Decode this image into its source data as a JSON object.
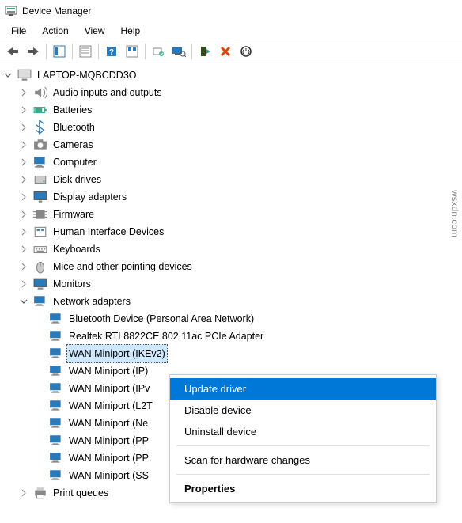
{
  "window": {
    "title": "Device Manager"
  },
  "menubar": [
    "File",
    "Action",
    "View",
    "Help"
  ],
  "root": {
    "name": "LAPTOP-MQBCDD3O"
  },
  "categories": [
    {
      "label": "Audio inputs and outputs",
      "icon": "speaker",
      "expanded": false
    },
    {
      "label": "Batteries",
      "icon": "battery",
      "expanded": false
    },
    {
      "label": "Bluetooth",
      "icon": "bluetooth",
      "expanded": false
    },
    {
      "label": "Cameras",
      "icon": "camera",
      "expanded": false
    },
    {
      "label": "Computer",
      "icon": "computer",
      "expanded": false
    },
    {
      "label": "Disk drives",
      "icon": "disk",
      "expanded": false
    },
    {
      "label": "Display adapters",
      "icon": "display",
      "expanded": false
    },
    {
      "label": "Firmware",
      "icon": "firmware",
      "expanded": false
    },
    {
      "label": "Human Interface Devices",
      "icon": "hid",
      "expanded": false
    },
    {
      "label": "Keyboards",
      "icon": "keyboard",
      "expanded": false
    },
    {
      "label": "Mice and other pointing devices",
      "icon": "mouse",
      "expanded": false
    },
    {
      "label": "Monitors",
      "icon": "monitor",
      "expanded": false
    },
    {
      "label": "Network adapters",
      "icon": "network",
      "expanded": true
    },
    {
      "label": "Print queues",
      "icon": "printer",
      "expanded": false
    }
  ],
  "network_children": [
    {
      "label": "Bluetooth Device (Personal Area Network)",
      "selected": false
    },
    {
      "label": "Realtek RTL8822CE 802.11ac PCIe Adapter",
      "selected": false
    },
    {
      "label": "WAN Miniport (IKEv2)",
      "selected": true
    },
    {
      "label": "WAN Miniport (IP)",
      "selected": false
    },
    {
      "label": "WAN Miniport (IPv",
      "selected": false
    },
    {
      "label": "WAN Miniport (L2T",
      "selected": false
    },
    {
      "label": "WAN Miniport (Ne",
      "selected": false
    },
    {
      "label": "WAN Miniport (PP",
      "selected": false
    },
    {
      "label": "WAN Miniport (PP",
      "selected": false
    },
    {
      "label": "WAN Miniport (SS",
      "selected": false
    }
  ],
  "context_menu": {
    "items": [
      {
        "label": "Update driver",
        "highlighted": true
      },
      {
        "label": "Disable device",
        "highlighted": false
      },
      {
        "label": "Uninstall device",
        "highlighted": false
      },
      {
        "sep": true
      },
      {
        "label": "Scan for hardware changes",
        "highlighted": false
      },
      {
        "sep": true
      },
      {
        "label": "Properties",
        "bold": true,
        "highlighted": false
      }
    ]
  },
  "watermark": "wsxdn.com"
}
